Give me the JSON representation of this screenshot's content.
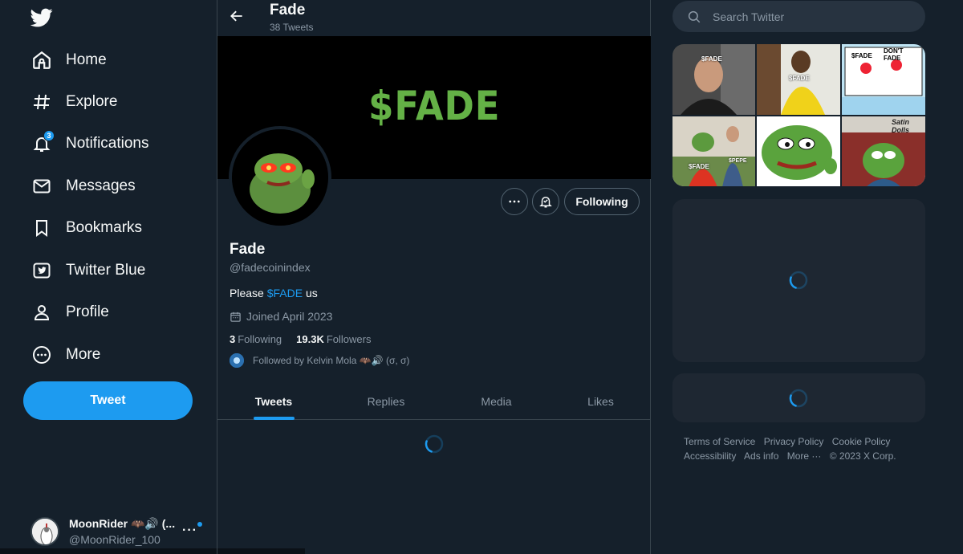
{
  "nav": {
    "items": [
      {
        "label": "Home",
        "icon": "home-icon"
      },
      {
        "label": "Explore",
        "icon": "hashtag-icon"
      },
      {
        "label": "Notifications",
        "icon": "bell-icon",
        "badge": "3"
      },
      {
        "label": "Messages",
        "icon": "envelope-icon"
      },
      {
        "label": "Bookmarks",
        "icon": "bookmark-icon"
      },
      {
        "label": "Twitter Blue",
        "icon": "twitter-blue-icon"
      },
      {
        "label": "Profile",
        "icon": "person-icon"
      },
      {
        "label": "More",
        "icon": "more-circle-icon"
      }
    ],
    "tweet_label": "Tweet"
  },
  "account": {
    "name": "MoonRider 🦇🔊 (...",
    "handle": "@MoonRider_100"
  },
  "header": {
    "name": "Fade",
    "tweet_count": "38 Tweets"
  },
  "banner": {
    "text": "$FADE"
  },
  "profile": {
    "name": "Fade",
    "handle": "@fadecoinindex",
    "bio_prefix": "Please ",
    "bio_link": "$FADE",
    "bio_suffix": " us",
    "joined": "Joined April 2023",
    "following_count": "3",
    "following_label": "Following",
    "followers_count": "19.3K",
    "followers_label": "Followers",
    "followed_by": "Followed by Kelvin Mola 🦇🔊 (σ, σ)",
    "following_button": "Following"
  },
  "tabs": [
    {
      "label": "Tweets",
      "active": true
    },
    {
      "label": "Replies",
      "active": false
    },
    {
      "label": "Media",
      "active": false
    },
    {
      "label": "Likes",
      "active": false
    }
  ],
  "search": {
    "placeholder": "Search Twitter"
  },
  "media_captions": {
    "cell1": "$FADE",
    "cell2": "$FADE",
    "cell3a": "$FADE",
    "cell3b": "DON'T FADE",
    "cell4a": "$FADE",
    "cell4b": "$PEPE",
    "cell6": "Satin Dolls"
  },
  "footer": {
    "links": [
      "Terms of Service",
      "Privacy Policy",
      "Cookie Policy",
      "Accessibility",
      "Ads info",
      "More ···",
      "© 2023 X Corp."
    ]
  },
  "colors": {
    "background": "#15202b",
    "accent": "#1d9bf0",
    "muted_text": "#8b98a5",
    "banner_text": "#64b146",
    "card": "#1e2732"
  }
}
